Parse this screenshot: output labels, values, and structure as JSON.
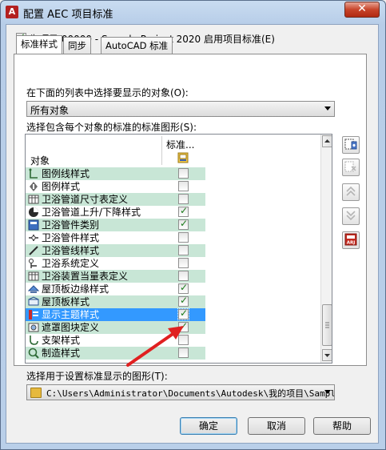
{
  "window": {
    "title": "配置 AEC 项目标准",
    "close_glyph": "✕"
  },
  "enable_checkbox": {
    "checked": true,
    "label": "为项目 00000 - Sample Project 2020 启用项目标准(E)"
  },
  "tabs": [
    {
      "label": "标准样式",
      "active": true
    },
    {
      "label": "同步",
      "active": false
    },
    {
      "label": "AutoCAD 标准",
      "active": false
    }
  ],
  "objects_prompt": "在下面的列表中选择要显示的对象(O):",
  "objects_combo": {
    "value": "所有对象"
  },
  "drawings_prompt": "选择包含每个对象的标准的标准图形(S):",
  "list": {
    "col_object": "对象",
    "col_standard": "标准...",
    "rows": [
      {
        "label": "图例线样式",
        "icon": "legend-line-icon",
        "checked": false
      },
      {
        "label": "图例样式",
        "icon": "legend-icon",
        "checked": false
      },
      {
        "label": "卫浴管道尺寸表定义",
        "icon": "table-icon",
        "checked": false
      },
      {
        "label": "卫浴管道上升/下降样式",
        "icon": "rise-drop-icon",
        "checked": true
      },
      {
        "label": "卫浴管件类别",
        "icon": "category-icon",
        "checked": true
      },
      {
        "label": "卫浴管件样式",
        "icon": "fitting-icon",
        "checked": false
      },
      {
        "label": "卫浴管线样式",
        "icon": "line-icon",
        "checked": false
      },
      {
        "label": "卫浴系统定义",
        "icon": "system-icon",
        "checked": false
      },
      {
        "label": "卫浴装置当量表定义",
        "icon": "table-icon",
        "checked": false
      },
      {
        "label": "屋顶板边缘样式",
        "icon": "roof-edge-icon",
        "checked": true
      },
      {
        "label": "屋顶板样式",
        "icon": "roof-slab-icon",
        "checked": true
      },
      {
        "label": "显示主题样式",
        "icon": "theme-icon",
        "checked": true,
        "selected": true
      },
      {
        "label": "遮罩图块定义",
        "icon": "mask-icon",
        "checked": true
      },
      {
        "label": "支架样式",
        "icon": "hanger-icon",
        "checked": false
      },
      {
        "label": "制造样式",
        "icon": "fab-icon",
        "checked": false
      }
    ]
  },
  "side_buttons": [
    {
      "icon": "add-drawing-icon",
      "enabled": true
    },
    {
      "icon": "remove-drawing-icon",
      "enabled": false
    },
    {
      "icon": "move-up-icon",
      "enabled": false
    },
    {
      "icon": "move-down-icon",
      "enabled": false
    },
    {
      "icon": "arj-icon",
      "enabled": true
    }
  ],
  "display_prompt": "选择用于设置标准显示的图形(T):",
  "display_combo": {
    "value": "C:\\Users\\Administrator\\Documents\\Autodesk\\我的项目\\Sample"
  },
  "buttons": {
    "ok": "确定",
    "cancel": "取消",
    "help": "帮助"
  },
  "colors": {
    "row_green": "#c8e6d6",
    "selection": "#3399ff",
    "arrow": "#e02020"
  }
}
